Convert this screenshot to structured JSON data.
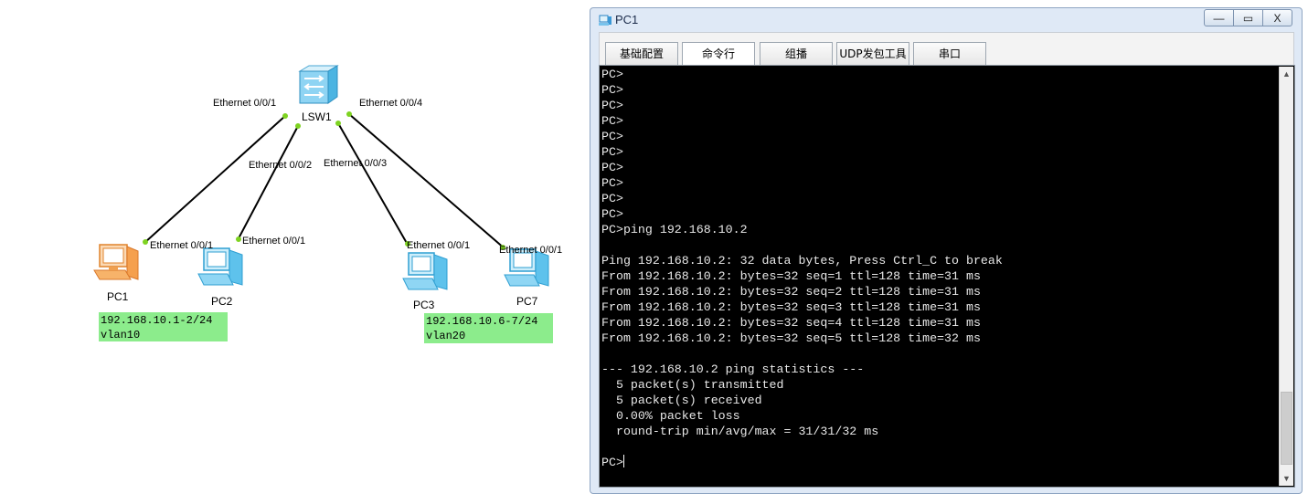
{
  "topology": {
    "switch": {
      "label": "LSW1"
    },
    "links": [
      {
        "switch_port": "Ethernet 0/0/1",
        "device_port": "Ethernet 0/0/1",
        "device": "PC1"
      },
      {
        "switch_port": "Ethernet 0/0/2",
        "device_port": "Ethernet 0/0/1",
        "device": "PC2"
      },
      {
        "switch_port": "Ethernet 0/0/3",
        "device_port": "Ethernet 0/0/1",
        "device": "PC3"
      },
      {
        "switch_port": "Ethernet 0/0/4",
        "device_port": "Ethernet 0/0/1",
        "device": "PC7"
      }
    ],
    "devices": [
      {
        "label": "PC1",
        "state": "selected"
      },
      {
        "label": "PC2",
        "state": "normal"
      },
      {
        "label": "PC3",
        "state": "normal"
      },
      {
        "label": "PC7",
        "state": "normal"
      }
    ],
    "notes": [
      {
        "lines": [
          "192.168.10.1-2/24",
          "vlan10"
        ]
      },
      {
        "lines": [
          "192.168.10.6-7/24",
          "vlan20"
        ]
      }
    ],
    "colors": {
      "link": "#000000",
      "port_dot": "#7ed321",
      "note_bg": "#8cec8c"
    }
  },
  "window": {
    "title": "PC1",
    "controls": {
      "minimize": "—",
      "maximize": "▭",
      "close": "X"
    },
    "tabs": [
      {
        "label": "基础配置",
        "active": false
      },
      {
        "label": "命令行",
        "active": true
      },
      {
        "label": "组播",
        "active": false
      },
      {
        "label": "UDP发包工具",
        "active": false
      },
      {
        "label": "串口",
        "active": false
      }
    ],
    "console": {
      "lines": [
        "PC>",
        "PC>",
        "PC>",
        "PC>",
        "PC>",
        "PC>",
        "PC>",
        "PC>",
        "PC>",
        "PC>",
        "PC>ping 192.168.10.2",
        "",
        "Ping 192.168.10.2: 32 data bytes, Press Ctrl_C to break",
        "From 192.168.10.2: bytes=32 seq=1 ttl=128 time=31 ms",
        "From 192.168.10.2: bytes=32 seq=2 ttl=128 time=31 ms",
        "From 192.168.10.2: bytes=32 seq=3 ttl=128 time=31 ms",
        "From 192.168.10.2: bytes=32 seq=4 ttl=128 time=31 ms",
        "From 192.168.10.2: bytes=32 seq=5 ttl=128 time=32 ms",
        "",
        "--- 192.168.10.2 ping statistics ---",
        "  5 packet(s) transmitted",
        "  5 packet(s) received",
        "  0.00% packet loss",
        "  round-trip min/avg/max = 31/31/32 ms",
        ""
      ],
      "prompt": "PC>"
    }
  }
}
